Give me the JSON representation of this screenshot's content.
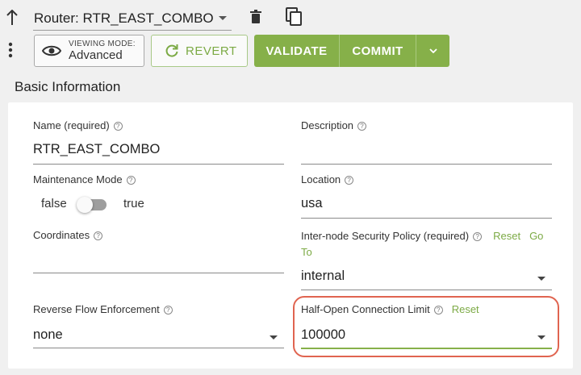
{
  "header": {
    "router_select_value": "Router: RTR_EAST_COMBO",
    "view_mode_label": "VIEWING MODE:",
    "view_mode_value": "Advanced",
    "revert_label": "REVERT",
    "validate_label": "VALIDATE",
    "commit_label": "COMMIT",
    "icons": {
      "back": "up-arrow-icon",
      "delete": "trash-icon",
      "copy": "copy-icon",
      "more": "more-vertical-icon",
      "eye": "eye-icon",
      "revert": "refresh-icon",
      "commit_menu": "chevron-down-icon"
    }
  },
  "section": {
    "title": "Basic Information"
  },
  "fields": {
    "name": {
      "label": "Name (required)",
      "value": "RTR_EAST_COMBO"
    },
    "description": {
      "label": "Description",
      "value": ""
    },
    "maintenance": {
      "label": "Maintenance Mode",
      "false_label": "false",
      "true_label": "true",
      "enabled": false
    },
    "location": {
      "label": "Location",
      "value": "usa"
    },
    "coordinates": {
      "label": "Coordinates",
      "value": ""
    },
    "security_policy": {
      "label": "Inter-node Security Policy (required)",
      "reset_label": "Reset",
      "goto_label": "Go",
      "goto_label_cont": "To",
      "value": "internal"
    },
    "reverse_flow": {
      "label": "Reverse Flow Enforcement",
      "value": "none"
    },
    "half_open": {
      "label": "Half-Open Connection Limit",
      "reset_label": "Reset",
      "value": "100000"
    }
  },
  "colors": {
    "accent": "#86b049",
    "link": "#7caa45",
    "highlight": "#e06450"
  }
}
